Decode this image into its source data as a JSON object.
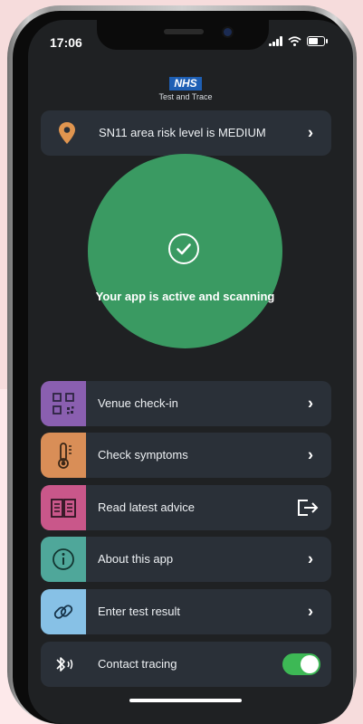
{
  "status_bar": {
    "time": "17:06"
  },
  "logo": {
    "brand": "NHS",
    "subtitle": "Test and Trace"
  },
  "risk_card": {
    "label": "SN11 area risk level is MEDIUM",
    "icon": "location-pin-icon"
  },
  "status_circle": {
    "text": "Your app is active and scanning",
    "color": "#3a9a62"
  },
  "menu": [
    {
      "label": "Venue check-in",
      "icon": "qr-code-icon",
      "color": "#8a5fb0"
    },
    {
      "label": "Check symptoms",
      "icon": "thermometer-icon",
      "color": "#d98e57"
    },
    {
      "label": "Read latest advice",
      "icon": "book-icon",
      "color": "#c9578a"
    },
    {
      "label": "About this app",
      "icon": "info-icon",
      "color": "#4fa79a"
    },
    {
      "label": "Enter test result",
      "icon": "link-icon",
      "color": "#87c1e6"
    }
  ],
  "contact_tracing": {
    "label": "Contact tracing",
    "icon": "bluetooth-icon",
    "enabled": true
  }
}
